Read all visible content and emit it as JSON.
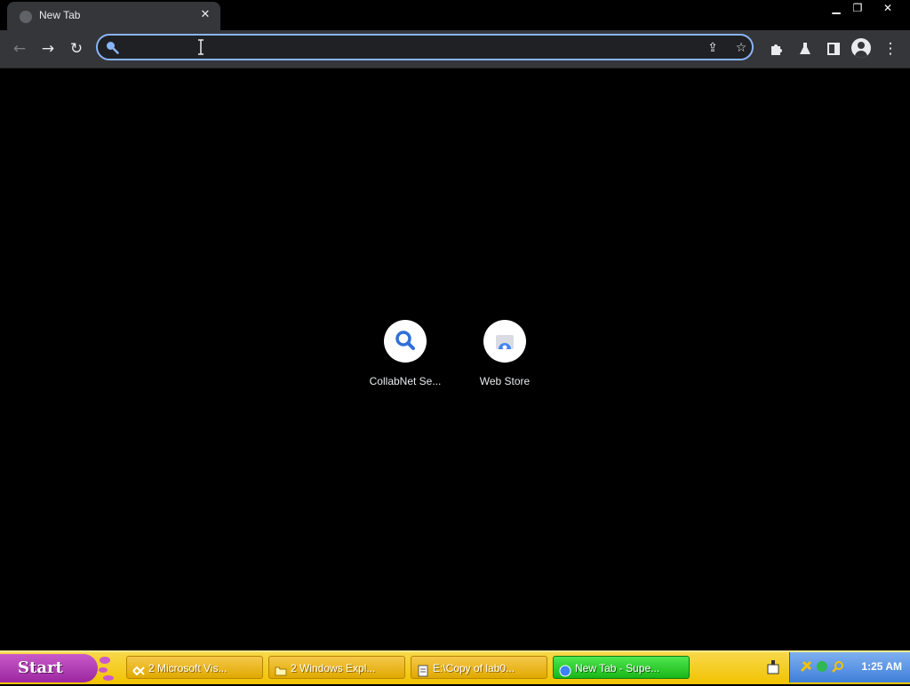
{
  "browser": {
    "tab": {
      "title": "New Tab"
    },
    "omnibox": {
      "value": "",
      "placeholder": ""
    }
  },
  "shortcuts": [
    {
      "label": "CollabNet Se..."
    },
    {
      "label": "Web Store"
    }
  ],
  "taskbar": {
    "start_label": "Start",
    "tasks": [
      {
        "label": "2 Microsoft Vis..."
      },
      {
        "label": "2 Windows Expl..."
      },
      {
        "label": "E:\\Copy of lab0..."
      },
      {
        "label": "New Tab - Supe..."
      }
    ],
    "clock": "1:25 AM"
  },
  "colors": {
    "accent": "#8ab4f8",
    "toolbar": "#35363a",
    "page_bg": "#000000",
    "taskbar": "#f2c200",
    "active_task": "#19b619"
  }
}
